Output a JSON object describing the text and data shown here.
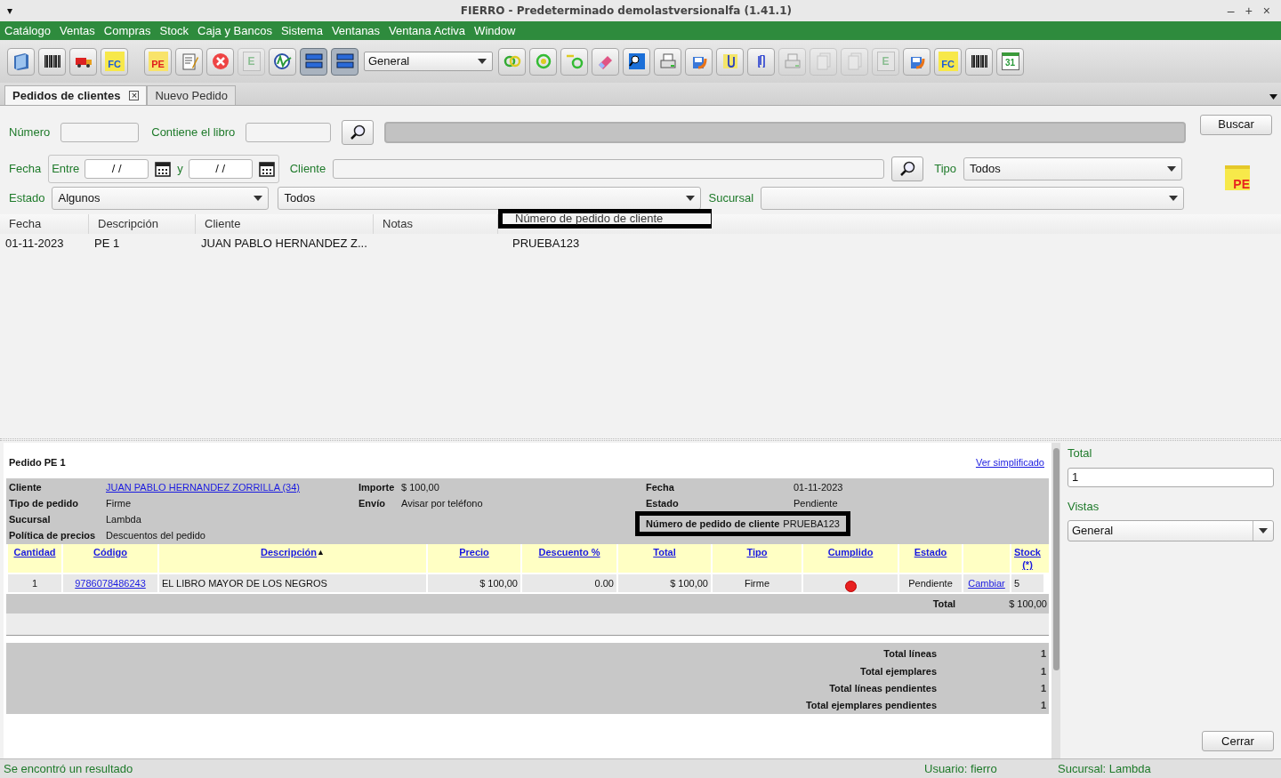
{
  "window": {
    "menu_glyph": "▾",
    "title": "FIERRO - Predeterminado demolastversionalfa (1.41.1)",
    "controls": [
      "–",
      "+",
      "×"
    ]
  },
  "menu": [
    "Catálogo",
    "Ventas",
    "Compras",
    "Stock",
    "Caja y Bancos",
    "Sistema",
    "Ventanas",
    "Ventana Activa",
    "Window"
  ],
  "toolbar": [
    {
      "kind": "book",
      "disabled": false,
      "pressed": false
    },
    {
      "kind": "barcode",
      "disabled": false,
      "pressed": false
    },
    {
      "kind": "truck",
      "disabled": false,
      "pressed": false
    },
    {
      "kind": "badge",
      "text": "FC",
      "disabled": false,
      "pressed": false
    },
    {
      "kind": "gap"
    },
    {
      "kind": "badge-red",
      "text": "PE",
      "disabled": false,
      "pressed": false
    },
    {
      "kind": "notepad",
      "disabled": false,
      "pressed": false
    },
    {
      "kind": "cancel",
      "disabled": false,
      "pressed": false
    },
    {
      "kind": "letter-doc",
      "text": "E",
      "disabled": true,
      "pressed": false
    },
    {
      "kind": "chart",
      "disabled": false,
      "pressed": false
    },
    {
      "kind": "rows",
      "disabled": false,
      "pressed": true
    },
    {
      "kind": "rows",
      "disabled": false,
      "pressed": true
    },
    {
      "kind": "select",
      "value": "General"
    },
    {
      "kind": "rings",
      "disabled": false,
      "pressed": false
    },
    {
      "kind": "target",
      "disabled": false,
      "pressed": false
    },
    {
      "kind": "hook",
      "disabled": false,
      "pressed": false
    },
    {
      "kind": "eraser",
      "disabled": false,
      "pressed": false
    },
    {
      "kind": "monitor",
      "disabled": false,
      "pressed": false
    },
    {
      "kind": "printer",
      "disabled": false,
      "pressed": false
    },
    {
      "kind": "save",
      "disabled": false,
      "pressed": false
    },
    {
      "kind": "clip-note",
      "disabled": false,
      "pressed": false
    },
    {
      "kind": "paperclip",
      "disabled": false,
      "pressed": false
    },
    {
      "kind": "printer",
      "disabled": true,
      "pressed": false
    },
    {
      "kind": "docs",
      "disabled": true,
      "pressed": false
    },
    {
      "kind": "docs",
      "disabled": true,
      "pressed": false
    },
    {
      "kind": "letter-doc",
      "text": "E",
      "disabled": true,
      "pressed": false
    },
    {
      "kind": "save",
      "disabled": false,
      "pressed": false
    },
    {
      "kind": "badge",
      "text": "FC",
      "disabled": false,
      "pressed": false
    },
    {
      "kind": "barcode",
      "disabled": false,
      "pressed": false
    },
    {
      "kind": "calendar",
      "text": "31",
      "disabled": false,
      "pressed": false
    }
  ],
  "tabs": [
    {
      "label": "Pedidos de clientes",
      "selected": true,
      "close": "×"
    },
    {
      "label": "Nuevo Pedido",
      "selected": false
    }
  ],
  "filters": {
    "numero_label": "Número",
    "libro_label": "Contiene el libro",
    "buscar": "Buscar",
    "fecha_label": "Fecha",
    "entre_label": "Entre",
    "date_from": "/ /",
    "y_label": "y",
    "date_to": "/ /",
    "cliente_label": "Cliente",
    "tipo_label": "Tipo",
    "tipo_value": "Todos",
    "estado_label": "Estado",
    "estado_value": "Algunos",
    "estado_value_2": "Todos",
    "sucursal_label": "Sucursal",
    "pe_icon_text": "PE"
  },
  "results": {
    "columns": [
      {
        "label": "Fecha",
        "highlighted": false
      },
      {
        "label": "Descripción",
        "highlighted": false
      },
      {
        "label": "Cliente",
        "highlighted": false
      },
      {
        "label": "Notas",
        "highlighted": false
      },
      {
        "label": "Número de pedido de cliente",
        "highlighted": true
      }
    ],
    "rows": [
      {
        "cells": [
          "01-11-2023",
          "PE 1",
          "JUAN PABLO HERNANDEZ Z...",
          null,
          "PRUEBA123"
        ]
      }
    ]
  },
  "detail": {
    "title": "Pedido PE 1",
    "simplified_link": "Ver simplificado",
    "info_left": [
      {
        "label": "Cliente",
        "value": "JUAN PABLO HERNANDEZ ZORRILLA (34)",
        "link": true
      },
      {
        "label": "Tipo de pedido",
        "value": "Firme",
        "link": false
      },
      {
        "label": "Sucursal",
        "value": "Lambda",
        "link": false
      },
      {
        "label": "Política de precios",
        "value": "Descuentos del pedido",
        "link": false
      }
    ],
    "info_mid": [
      {
        "label": "Importe",
        "value": "$ 100,00"
      },
      {
        "label": "Envío",
        "value": "Avisar por teléfono"
      }
    ],
    "info_right": [
      {
        "label": "Fecha",
        "value": "01-11-2023",
        "highlighted": false
      },
      {
        "label": "Estado",
        "value": "Pendiente",
        "highlighted": false
      },
      {
        "label": "Número de pedido de cliente",
        "value": "PRUEBA123",
        "highlighted": true
      }
    ],
    "line_columns": [
      "Cantidad",
      "Código",
      "Descripción",
      "Precio",
      "Descuento %",
      "Total",
      "Tipo",
      "Cumplido",
      "Estado",
      "Stock (*)"
    ],
    "sort_glyph": "▲",
    "lines": [
      {
        "cantidad": "1",
        "codigo": "9786078486243",
        "descripcion": "EL LIBRO MAYOR DE LOS NEGROS",
        "precio": "$ 100,00",
        "descuento": "0.00",
        "total": "$ 100,00",
        "tipo": "Firme",
        "fulfilled": false,
        "estado": "Pendiente",
        "action": "Cambiar",
        "stock": "5"
      }
    ],
    "total_label": "Total",
    "total_value": "$ 100,00",
    "summary": [
      {
        "label": "Total líneas",
        "value": "1"
      },
      {
        "label": "Total ejemplares",
        "value": "1"
      },
      {
        "label": "Total líneas pendientes",
        "value": "1"
      },
      {
        "label": "Total ejemplares pendientes",
        "value": "1"
      }
    ]
  },
  "side": {
    "total_label": "Total",
    "total_value": "1",
    "vistas_label": "Vistas",
    "vistas_value": "General",
    "close": "Cerrar"
  },
  "status": {
    "message": "Se encontró un resultado",
    "user": "Usuario: fierro",
    "branch": "Sucursal: Lambda"
  }
}
